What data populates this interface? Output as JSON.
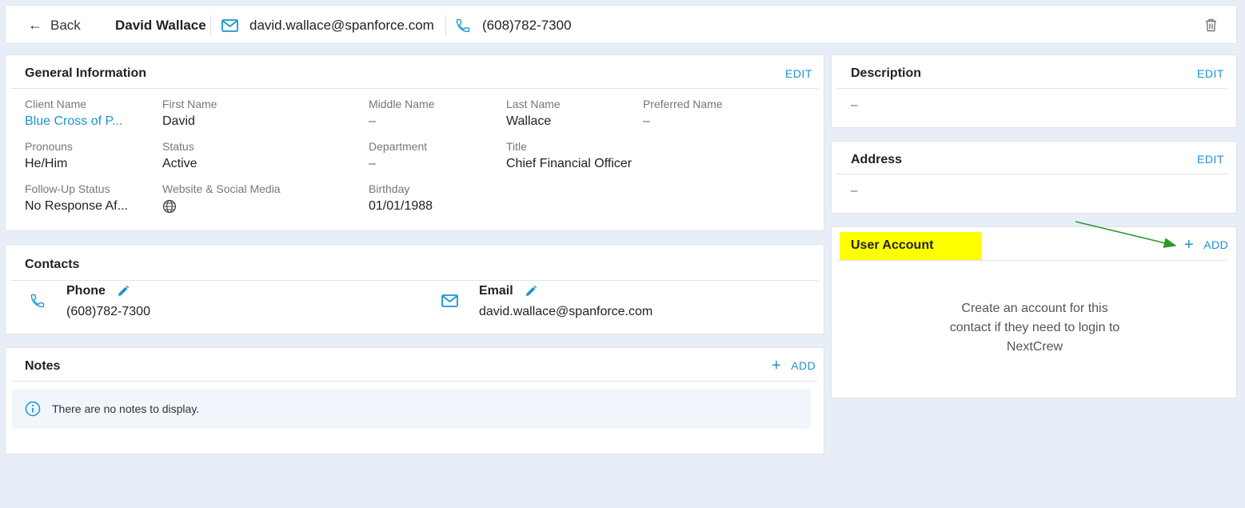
{
  "header": {
    "back_label": "Back",
    "contact_name": "David Wallace",
    "email": "david.wallace@spanforce.com",
    "phone": "(608)782-7300"
  },
  "general": {
    "title": "General Information",
    "edit_label": "EDIT",
    "fields": {
      "client_name": {
        "label": "Client Name",
        "value": "Blue Cross of P..."
      },
      "first_name": {
        "label": "First Name",
        "value": "David"
      },
      "middle_name": {
        "label": "Middle Name",
        "value": "–"
      },
      "last_name": {
        "label": "Last Name",
        "value": "Wallace"
      },
      "preferred_name": {
        "label": "Preferred Name",
        "value": "–"
      },
      "pronouns": {
        "label": "Pronouns",
        "value": "He/Him"
      },
      "status": {
        "label": "Status",
        "value": "Active"
      },
      "department": {
        "label": "Department",
        "value": "–"
      },
      "title": {
        "label": "Title",
        "value": "Chief Financial Officer"
      },
      "follow_up": {
        "label": "Follow-Up Status",
        "value": "No Response Af..."
      },
      "website": {
        "label": "Website & Social Media"
      },
      "birthday": {
        "label": "Birthday",
        "value": "01/01/1988"
      }
    }
  },
  "contacts": {
    "title": "Contacts",
    "phone_label": "Phone",
    "phone_value": "(608)782-7300",
    "email_label": "Email",
    "email_value": "david.wallace@spanforce.com"
  },
  "notes": {
    "title": "Notes",
    "add_label": "ADD",
    "empty_message": "There are no notes to display."
  },
  "description": {
    "title": "Description",
    "edit_label": "EDIT",
    "value": "–"
  },
  "address": {
    "title": "Address",
    "edit_label": "EDIT",
    "value": "–"
  },
  "user_account": {
    "title": "User Account",
    "add_label": "ADD",
    "empty_line1": "Create an account for this",
    "empty_line2": "contact if they need to login to",
    "empty_line3": "NextCrew"
  },
  "colors": {
    "accent": "#1a93d6",
    "highlight": "#ffff00",
    "annotation_arrow": "#2a9a2a"
  },
  "icons": [
    "arrow-left-icon",
    "mail-icon",
    "phone-icon",
    "trash-icon",
    "globe-icon",
    "pencil-icon",
    "plus-icon",
    "info-icon"
  ]
}
